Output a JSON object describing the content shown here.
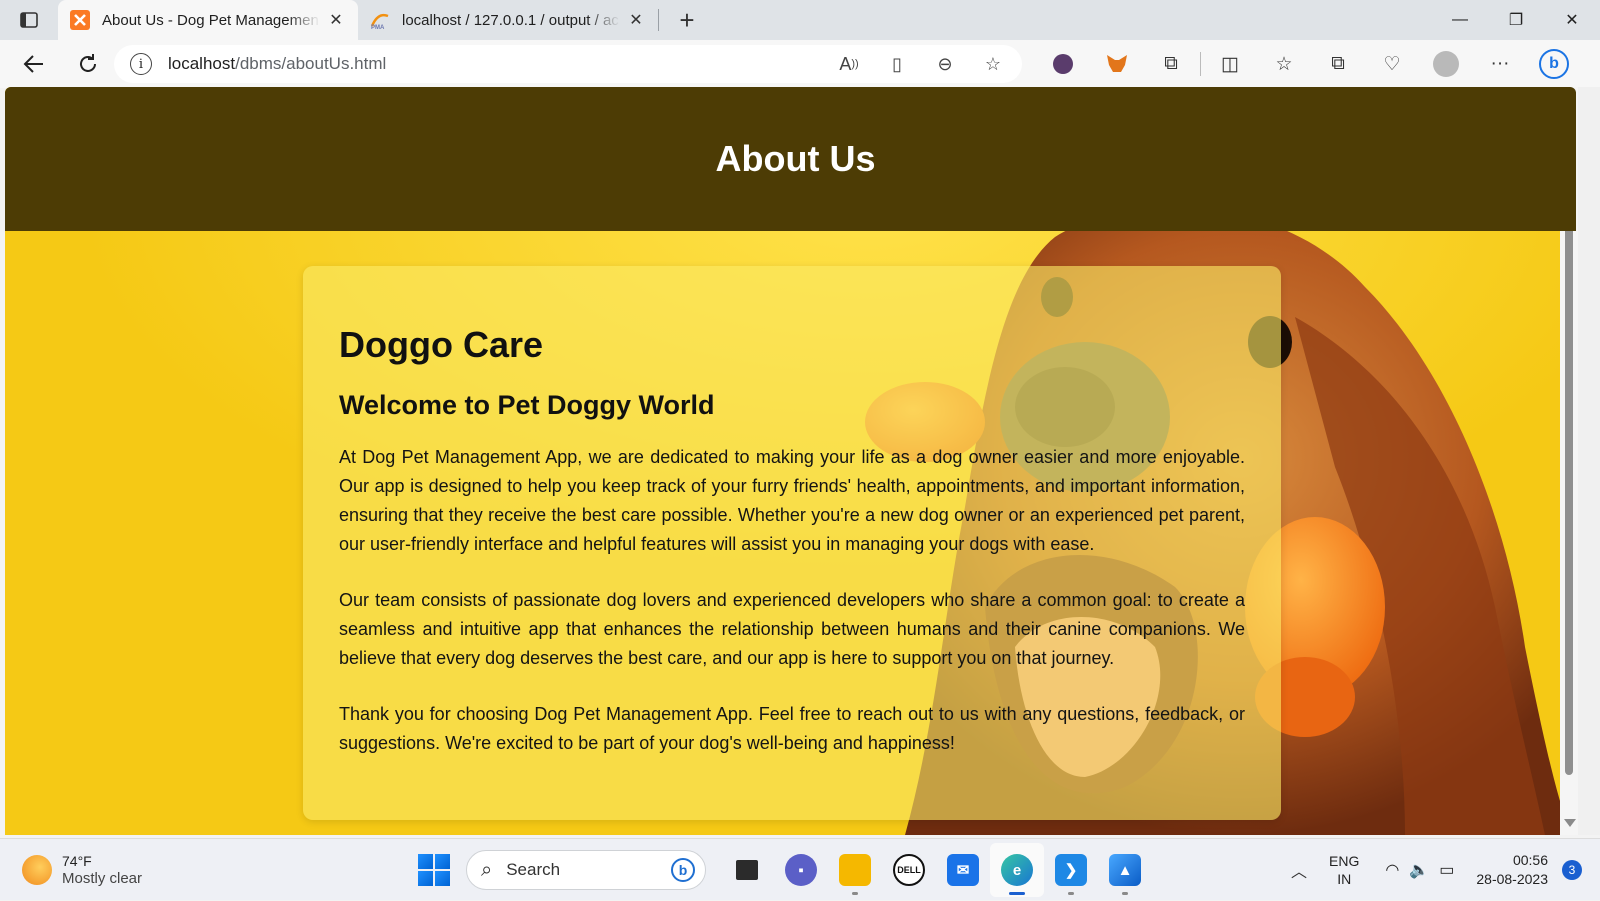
{
  "browser": {
    "tabs": [
      {
        "title": "About Us - Dog Pet Managemen",
        "active": true
      },
      {
        "title": "localhost / 127.0.0.1 / output / ac",
        "active": false
      }
    ],
    "url_host": "localhost",
    "url_path": "/dbms/aboutUs.html",
    "window_controls": {
      "minimize": "—",
      "restore": "❐",
      "close": "✕"
    }
  },
  "page": {
    "header_title": "About Us",
    "card_title": "Doggo Care",
    "card_subtitle": "Welcome to Pet Doggy World",
    "paragraphs": [
      "At Dog Pet Management App, we are dedicated to making your life as a dog owner easier and more enjoyable. Our app is designed to help you keep track of your furry friends' health, appointments, and important information, ensuring that they receive the best care possible. Whether you're a new dog owner or an experienced pet parent, our user-friendly interface and helpful features will assist you in managing your dogs with ease.",
      "Our team consists of passionate dog lovers and experienced developers who share a common goal: to create a seamless and intuitive app that enhances the relationship between humans and their canine companions. We believe that every dog deserves the best care, and our app is here to support you on that journey.",
      "Thank you for choosing Dog Pet Management App. Feel free to reach out to us with any questions, feedback, or suggestions. We're excited to be part of your dog's well-being and happiness!"
    ],
    "colors": {
      "header_bg": "#4d3c05",
      "page_bg": "#f7d21a",
      "dog_fur": "#b5581f"
    }
  },
  "taskbar": {
    "weather_temp": "74°F",
    "weather_desc": "Mostly clear",
    "search_placeholder": "Search",
    "lang_line1": "ENG",
    "lang_line2": "IN",
    "time": "00:56",
    "date": "28-08-2023",
    "notification_count": "3"
  }
}
